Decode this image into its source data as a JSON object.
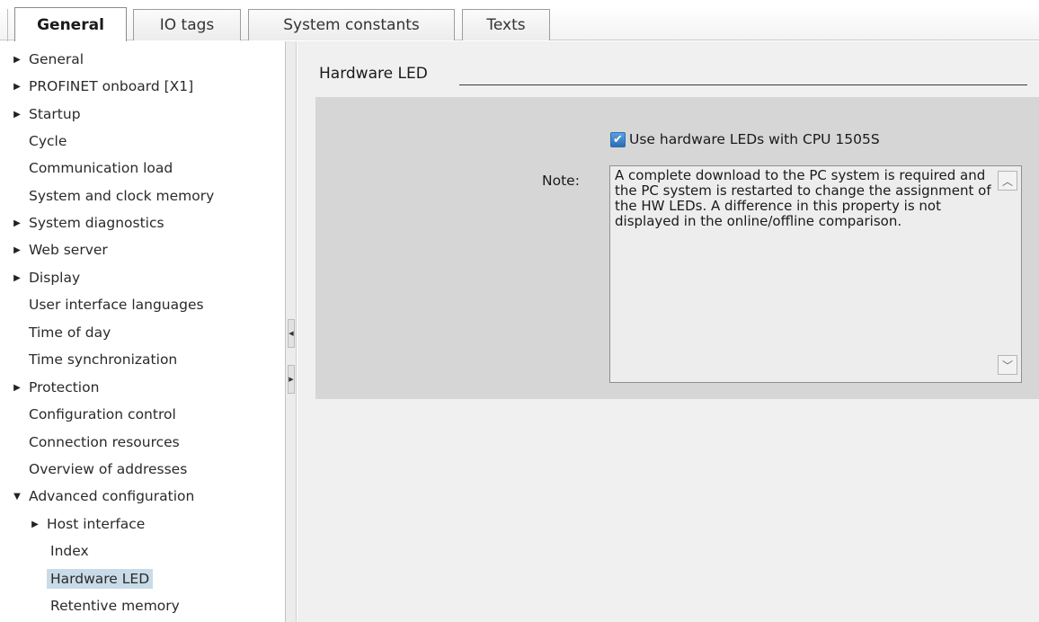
{
  "tabs": [
    {
      "label": "General",
      "active": true
    },
    {
      "label": "IO tags",
      "active": false
    },
    {
      "label": "System constants",
      "active": false
    },
    {
      "label": "Texts",
      "active": false
    }
  ],
  "nav": [
    {
      "label": "General",
      "expandable": true
    },
    {
      "label": "PROFINET onboard [X1]",
      "expandable": true
    },
    {
      "label": "Startup",
      "expandable": true
    },
    {
      "label": "Cycle",
      "expandable": false
    },
    {
      "label": "Communication load",
      "expandable": false
    },
    {
      "label": "System and clock memory",
      "expandable": false
    },
    {
      "label": "System diagnostics",
      "expandable": true
    },
    {
      "label": "Web server",
      "expandable": true
    },
    {
      "label": "Display",
      "expandable": true
    },
    {
      "label": "User interface languages",
      "expandable": false
    },
    {
      "label": "Time of day",
      "expandable": false
    },
    {
      "label": "Time synchronization",
      "expandable": false
    },
    {
      "label": "Protection",
      "expandable": true
    },
    {
      "label": "Configuration control",
      "expandable": false
    },
    {
      "label": "Connection resources",
      "expandable": false
    },
    {
      "label": "Overview of addresses",
      "expandable": false
    },
    {
      "label": "Advanced configuration",
      "expanded": true
    },
    {
      "label": "Host interface",
      "expandable": true
    },
    {
      "label": "Index",
      "expandable": false
    },
    {
      "label": "Hardware LED",
      "expandable": false,
      "selected": true
    },
    {
      "label": "Retentive memory",
      "expandable": false
    }
  ],
  "section": {
    "title": "Hardware LED",
    "checkbox_label": "Use hardware LEDs with CPU 1505S",
    "checkbox_checked": true,
    "note_label": "Note:",
    "note_text": "A complete download to the PC system is required and the PC system is restarted to change the assignment of the HW LEDs. A difference in this property is not displayed in the online/offline comparison."
  }
}
